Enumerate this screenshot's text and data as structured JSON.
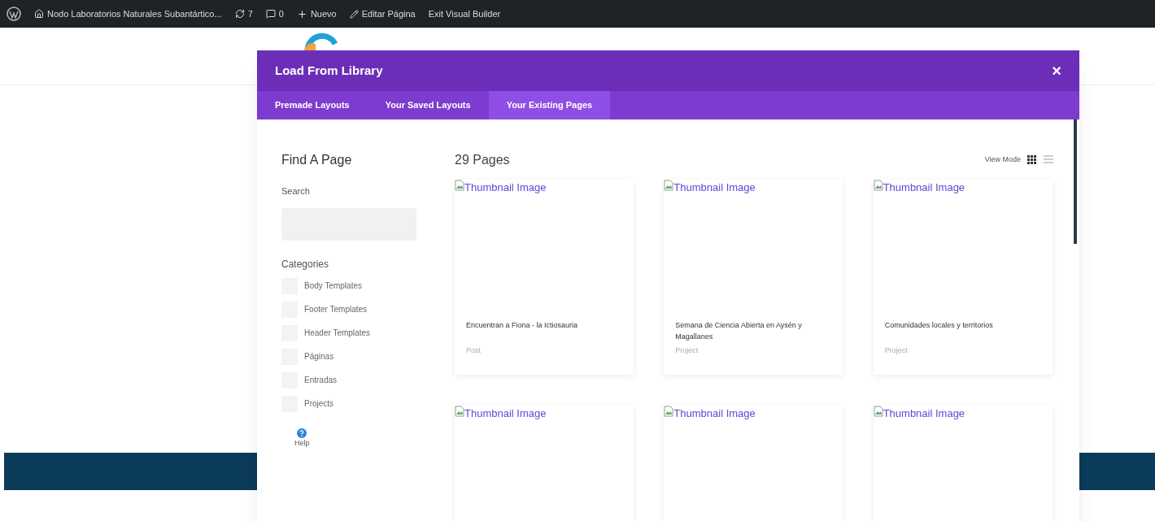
{
  "admin_bar": {
    "site": "Nodo Laboratorios Naturales Subantártico...",
    "updates": "7",
    "comments": "0",
    "new": "Nuevo",
    "edit": "Editar Página",
    "exit": "Exit Visual Builder"
  },
  "modal": {
    "title": "Load From Library",
    "close": "×",
    "tabs": [
      {
        "label": "Premade Layouts",
        "selected": false
      },
      {
        "label": "Your Saved Layouts",
        "selected": false
      },
      {
        "label": "Your Existing Pages",
        "selected": true
      }
    ],
    "sidebar": {
      "heading": "Find A Page",
      "search_label": "Search",
      "categories_label": "Categories",
      "categories": [
        {
          "label": "Body Templates",
          "checked": false
        },
        {
          "label": "Footer Templates",
          "checked": false
        },
        {
          "label": "Header Templates",
          "checked": false
        },
        {
          "label": "Páginas",
          "checked": false
        },
        {
          "label": "Entradas",
          "checked": false
        },
        {
          "label": "Projects",
          "checked": false
        }
      ],
      "help": "Help"
    },
    "count": "29 Pages",
    "view_mode_label": "View Mode",
    "view_modes": [
      {
        "kind": "grid",
        "selected": true
      },
      {
        "kind": "list",
        "selected": false
      }
    ],
    "cards": [
      {
        "thumbnail_alt": "Thumbnail Image",
        "title": "Encuentran a Fiona - la Ictiosauria",
        "type": "Post"
      },
      {
        "thumbnail_alt": "Thumbnail Image",
        "title": "Semana de Ciencia Abierta en Aysén y Magallanes",
        "type": "Project"
      },
      {
        "thumbnail_alt": "Thumbnail Image",
        "title": "Comunidades locales y territorios",
        "type": "Project"
      },
      {
        "thumbnail_alt": "Thumbnail Image"
      },
      {
        "thumbnail_alt": "Thumbnail Image"
      },
      {
        "thumbnail_alt": "Thumbnail Image"
      }
    ]
  }
}
